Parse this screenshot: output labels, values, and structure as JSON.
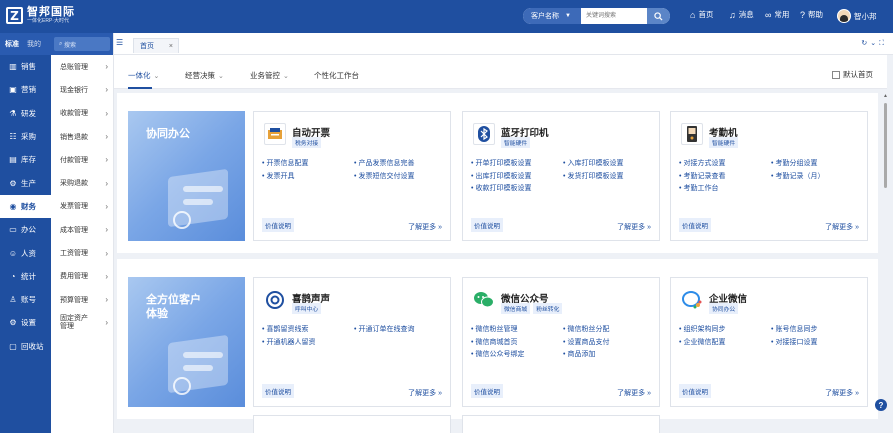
{
  "app": {
    "logo_letter": "Z",
    "name": "智邦国际",
    "slogan": "一体化ERP·大时代"
  },
  "search": {
    "select_label": "客户名称",
    "placeholder": "关键词搜索"
  },
  "topnav": {
    "home": "首页",
    "messages": "消息",
    "common": "常用",
    "help": "帮助",
    "user": "智小邦"
  },
  "sidebar": {
    "tabs": [
      "标准",
      "我的"
    ],
    "search_placeholder": "搜索",
    "items": [
      {
        "label": "销售",
        "icon": "chart-icon"
      },
      {
        "label": "营销",
        "icon": "marketing-icon"
      },
      {
        "label": "研发",
        "icon": "rd-icon"
      },
      {
        "label": "采购",
        "icon": "purchase-icon"
      },
      {
        "label": "库存",
        "icon": "inventory-icon"
      },
      {
        "label": "生产",
        "icon": "production-icon"
      },
      {
        "label": "财务",
        "icon": "finance-icon"
      },
      {
        "label": "办公",
        "icon": "office-icon"
      },
      {
        "label": "人资",
        "icon": "hr-icon"
      },
      {
        "label": "统计",
        "icon": "stats-icon"
      },
      {
        "label": "账号",
        "icon": "account-icon"
      },
      {
        "label": "设置",
        "icon": "settings-icon"
      },
      {
        "label": "回收站",
        "icon": "recycle-icon"
      }
    ],
    "sub_items": [
      "总账管理",
      "现金银行",
      "收款管理",
      "销售退款",
      "付款管理",
      "采购退款",
      "发票管理",
      "成本管理",
      "工资管理",
      "费用管理",
      "预算管理",
      "固定资产管理"
    ]
  },
  "tabs": {
    "home_tab": "首页"
  },
  "subnav": {
    "items": [
      "一体化",
      "经营决策",
      "业务管控",
      "个性化工作台"
    ],
    "default_home": "默认首页"
  },
  "sections": [
    {
      "banner": "协同办公",
      "cards": [
        {
          "title": "自动开票",
          "tags": [
            "税务对接"
          ],
          "links": [
            "开票信息配置",
            "发票开具",
            "产品发票信息完善",
            "发票短信交付设置"
          ],
          "value": "价值说明",
          "more": "了解更多"
        },
        {
          "title": "蓝牙打印机",
          "tags": [
            "智能硬件"
          ],
          "links": [
            "开单打印模板设置",
            "出库打印模板设置",
            "收款打印模板设置",
            "入库打印模板设置",
            "发货打印模板设置"
          ],
          "value": "价值说明",
          "more": "了解更多"
        },
        {
          "title": "考勤机",
          "tags": [
            "智能硬件"
          ],
          "links": [
            "对接方式设置",
            "考勤记录查看",
            "考勤工作台",
            "考勤分组设置",
            "考勤记录（月）"
          ],
          "value": "价值说明",
          "more": "了解更多"
        }
      ]
    },
    {
      "banner": "全方位客户体验",
      "cards": [
        {
          "title": "喜鹊声声",
          "tags": [
            "呼叫中心"
          ],
          "links": [
            "喜鹊留资线索",
            "开通机器人留资",
            "开通订单在线查询"
          ],
          "value": "价值说明",
          "more": "了解更多"
        },
        {
          "title": "微信公众号",
          "tags": [
            "微信商城",
            "粉丝转化"
          ],
          "links": [
            "微信粉丝管理",
            "微信商城首页",
            "微信公众号绑定",
            "微信粉丝分配",
            "设置商品支付",
            "商品添加"
          ],
          "value": "价值说明",
          "more": "了解更多"
        },
        {
          "title": "企业微信",
          "tags": [
            "协同办公"
          ],
          "links": [
            "组织架构同步",
            "企业微信配置",
            "账号信息同步",
            "对接接口设置"
          ],
          "value": "价值说明",
          "more": "了解更多"
        }
      ]
    }
  ]
}
